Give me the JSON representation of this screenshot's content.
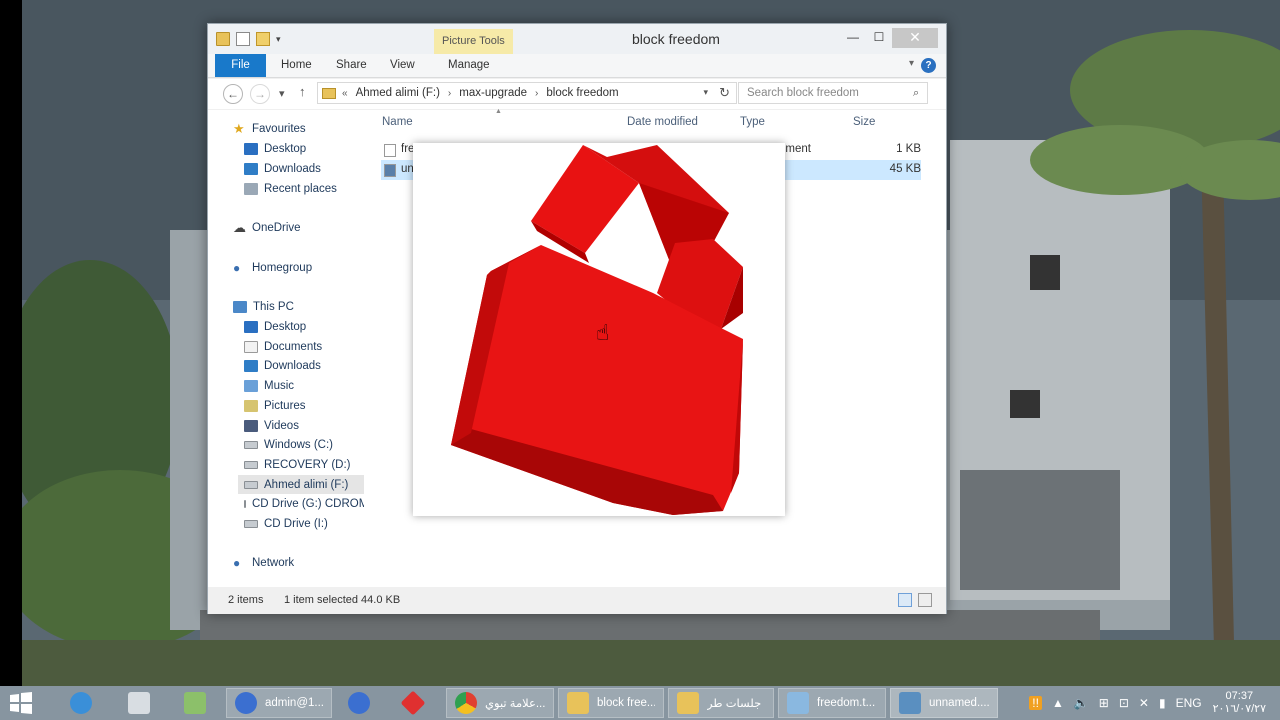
{
  "window": {
    "title": "block freedom",
    "contextual_tab": "Picture Tools",
    "ribbon_tabs": [
      "File",
      "Home",
      "Share",
      "View",
      "Manage"
    ],
    "controls": {
      "minimize": "—",
      "maximize": "☐",
      "close": "✕"
    }
  },
  "address": {
    "prefix": "«",
    "segments": [
      "Ahmed alimi (F:)",
      "max-upgrade",
      "block freedom"
    ],
    "search_placeholder": "Search block freedom"
  },
  "navpane": {
    "favourites": {
      "label": "Favourites",
      "items": [
        "Desktop",
        "Downloads",
        "Recent places"
      ]
    },
    "onedrive": "OneDrive",
    "homegroup": "Homegroup",
    "thispc": {
      "label": "This PC",
      "items": [
        "Desktop",
        "Documents",
        "Downloads",
        "Music",
        "Pictures",
        "Videos",
        "Windows (C:)",
        "RECOVERY (D:)",
        "Ahmed alimi (F:)",
        "CD Drive (G:) CDROM",
        "CD Drive (I:)"
      ]
    },
    "network": "Network"
  },
  "filelist": {
    "columns": [
      "Name",
      "Date modified",
      "Type",
      "Size"
    ],
    "rows": [
      {
        "name": "fre",
        "type": "ument",
        "size": "1 KB"
      },
      {
        "name": "un",
        "type": "",
        "size": "45 KB"
      }
    ]
  },
  "status": {
    "item_count": "2 items",
    "selection": "1 item selected  44.0 KB"
  },
  "taskbar": {
    "items": [
      {
        "label": "admin@1...",
        "color": "#3b6fd0"
      },
      {
        "label": "",
        "color": "#3b6fd0"
      },
      {
        "label": "",
        "color": "#e03030"
      },
      {
        "label": "علامة تبوي...",
        "color": "#e8b020"
      },
      {
        "label": "block free...",
        "color": "#e8c25a"
      },
      {
        "label": "جلسات طر",
        "color": "#e8c25a"
      },
      {
        "label": "freedom.t...",
        "color": "#8ab8e0"
      },
      {
        "label": "unnamed....",
        "color": "#5a8fc0"
      }
    ],
    "language": "ENG",
    "time": "07:37",
    "date": "٢٠١٦/٠٧/٢٧"
  },
  "colors": {
    "accent": "#1979ca",
    "block_red": "#e01010"
  }
}
